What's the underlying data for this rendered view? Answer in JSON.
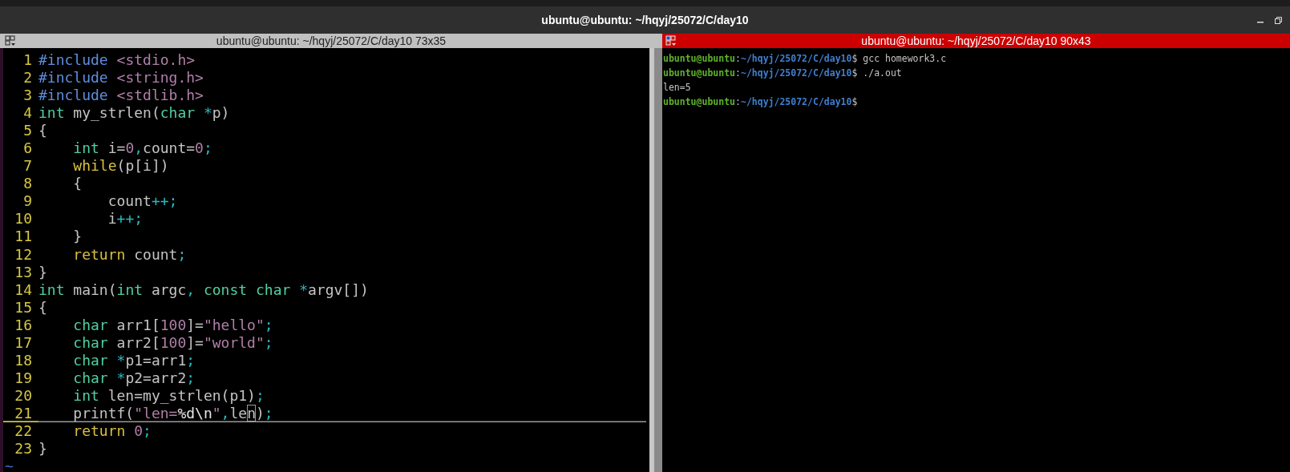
{
  "window": {
    "title": "ubuntu@ubuntu: ~/hqyj/25072/C/day10"
  },
  "left_pane": {
    "title": "ubuntu@ubuntu: ~/hqyj/25072/C/day10 73x35",
    "focused": false,
    "editor": {
      "tilde": "~",
      "lines": [
        {
          "number": "1",
          "current": false,
          "tokens": [
            {
              "kind": "pre",
              "text": "#include "
            },
            {
              "kind": "str",
              "text": "<stdio.h>"
            }
          ]
        },
        {
          "number": "2",
          "current": false,
          "tokens": [
            {
              "kind": "pre",
              "text": "#include "
            },
            {
              "kind": "str",
              "text": "<string.h>"
            }
          ]
        },
        {
          "number": "3",
          "current": false,
          "tokens": [
            {
              "kind": "pre",
              "text": "#include "
            },
            {
              "kind": "str",
              "text": "<stdlib.h>"
            }
          ]
        },
        {
          "number": "4",
          "current": false,
          "tokens": [
            {
              "kind": "type",
              "text": "int"
            },
            {
              "kind": "plain",
              "text": " my_strlen("
            },
            {
              "kind": "type",
              "text": "char "
            },
            {
              "kind": "op",
              "text": "*"
            },
            {
              "kind": "plain",
              "text": "p)"
            }
          ]
        },
        {
          "number": "5",
          "current": false,
          "tokens": [
            {
              "kind": "plain",
              "text": "{"
            }
          ]
        },
        {
          "number": "6",
          "current": false,
          "tokens": [
            {
              "kind": "type",
              "text": "    int"
            },
            {
              "kind": "plain",
              "text": " i="
            },
            {
              "kind": "num",
              "text": "0"
            },
            {
              "kind": "op",
              "text": ","
            },
            {
              "kind": "plain",
              "text": "count="
            },
            {
              "kind": "num",
              "text": "0"
            },
            {
              "kind": "op",
              "text": ";"
            }
          ]
        },
        {
          "number": "7",
          "current": false,
          "tokens": [
            {
              "kind": "kw",
              "text": "    while"
            },
            {
              "kind": "plain",
              "text": "(p[i])"
            }
          ]
        },
        {
          "number": "8",
          "current": false,
          "tokens": [
            {
              "kind": "plain",
              "text": "    {"
            }
          ]
        },
        {
          "number": "9",
          "current": false,
          "tokens": [
            {
              "kind": "plain",
              "text": "        count"
            },
            {
              "kind": "op",
              "text": "++;"
            }
          ]
        },
        {
          "number": "10",
          "current": false,
          "tokens": [
            {
              "kind": "plain",
              "text": "        i"
            },
            {
              "kind": "op",
              "text": "++;"
            }
          ]
        },
        {
          "number": "11",
          "current": false,
          "tokens": [
            {
              "kind": "plain",
              "text": "    }"
            }
          ]
        },
        {
          "number": "12",
          "current": false,
          "tokens": [
            {
              "kind": "kw",
              "text": "    return"
            },
            {
              "kind": "plain",
              "text": " count"
            },
            {
              "kind": "op",
              "text": ";"
            }
          ]
        },
        {
          "number": "13",
          "current": false,
          "tokens": [
            {
              "kind": "plain",
              "text": "}"
            }
          ]
        },
        {
          "number": "14",
          "current": false,
          "tokens": [
            {
              "kind": "type",
              "text": "int"
            },
            {
              "kind": "plain",
              "text": " main("
            },
            {
              "kind": "type",
              "text": "int"
            },
            {
              "kind": "plain",
              "text": " argc"
            },
            {
              "kind": "op",
              "text": ", "
            },
            {
              "kind": "type",
              "text": "const char "
            },
            {
              "kind": "op",
              "text": "*"
            },
            {
              "kind": "plain",
              "text": "argv[])"
            }
          ]
        },
        {
          "number": "15",
          "current": false,
          "tokens": [
            {
              "kind": "plain",
              "text": "{"
            }
          ]
        },
        {
          "number": "16",
          "current": false,
          "tokens": [
            {
              "kind": "type",
              "text": "    char"
            },
            {
              "kind": "plain",
              "text": " arr1["
            },
            {
              "kind": "num",
              "text": "100"
            },
            {
              "kind": "plain",
              "text": "]="
            },
            {
              "kind": "str",
              "text": "\"hello\""
            },
            {
              "kind": "op",
              "text": ";"
            }
          ]
        },
        {
          "number": "17",
          "current": false,
          "tokens": [
            {
              "kind": "type",
              "text": "    char"
            },
            {
              "kind": "plain",
              "text": " arr2["
            },
            {
              "kind": "num",
              "text": "100"
            },
            {
              "kind": "plain",
              "text": "]="
            },
            {
              "kind": "str",
              "text": "\"world\""
            },
            {
              "kind": "op",
              "text": ";"
            }
          ]
        },
        {
          "number": "18",
          "current": false,
          "tokens": [
            {
              "kind": "type",
              "text": "    char "
            },
            {
              "kind": "op",
              "text": "*"
            },
            {
              "kind": "plain",
              "text": "p1=arr1"
            },
            {
              "kind": "op",
              "text": ";"
            }
          ]
        },
        {
          "number": "19",
          "current": false,
          "tokens": [
            {
              "kind": "type",
              "text": "    char "
            },
            {
              "kind": "op",
              "text": "*"
            },
            {
              "kind": "plain",
              "text": "p2=arr2"
            },
            {
              "kind": "op",
              "text": ";"
            }
          ]
        },
        {
          "number": "20",
          "current": false,
          "tokens": [
            {
              "kind": "type",
              "text": "    int"
            },
            {
              "kind": "plain",
              "text": " len=my_strlen(p1)"
            },
            {
              "kind": "op",
              "text": ";"
            }
          ]
        },
        {
          "number": "21",
          "current": true,
          "tokens": [
            {
              "kind": "plain",
              "text": "    printf("
            },
            {
              "kind": "str",
              "text": "\"len="
            },
            {
              "kind": "special",
              "text": "%d\\n"
            },
            {
              "kind": "str",
              "text": "\""
            },
            {
              "kind": "op",
              "text": ","
            },
            {
              "kind": "plain",
              "text": "le"
            },
            {
              "kind": "cursor",
              "text": "n"
            },
            {
              "kind": "plain",
              "text": ")"
            },
            {
              "kind": "op",
              "text": ";"
            }
          ]
        },
        {
          "number": "22",
          "current": false,
          "tokens": [
            {
              "kind": "kw",
              "text": "    return "
            },
            {
              "kind": "num",
              "text": "0"
            },
            {
              "kind": "op",
              "text": ";"
            }
          ]
        },
        {
          "number": "23",
          "current": false,
          "tokens": [
            {
              "kind": "plain",
              "text": "}"
            }
          ]
        }
      ]
    }
  },
  "right_pane": {
    "title": "ubuntu@ubuntu: ~/hqyj/25072/C/day10 90x43",
    "focused": true,
    "lines": [
      [
        {
          "kind": "user",
          "text": "ubuntu@ubuntu"
        },
        {
          "kind": "plain",
          "text": ":"
        },
        {
          "kind": "path",
          "text": "~/hqyj/25072/C/day10"
        },
        {
          "kind": "plain",
          "text": "$ gcc homework3.c"
        }
      ],
      [
        {
          "kind": "user",
          "text": "ubuntu@ubuntu"
        },
        {
          "kind": "plain",
          "text": ":"
        },
        {
          "kind": "path",
          "text": "~/hqyj/25072/C/day10"
        },
        {
          "kind": "plain",
          "text": "$ ./a.out"
        }
      ],
      [
        {
          "kind": "plain",
          "text": "len=5"
        }
      ],
      [
        {
          "kind": "user",
          "text": "ubuntu@ubuntu"
        },
        {
          "kind": "plain",
          "text": ":"
        },
        {
          "kind": "path",
          "text": "~/hqyj/25072/C/day10"
        },
        {
          "kind": "plain",
          "text": "$"
        }
      ]
    ]
  }
}
